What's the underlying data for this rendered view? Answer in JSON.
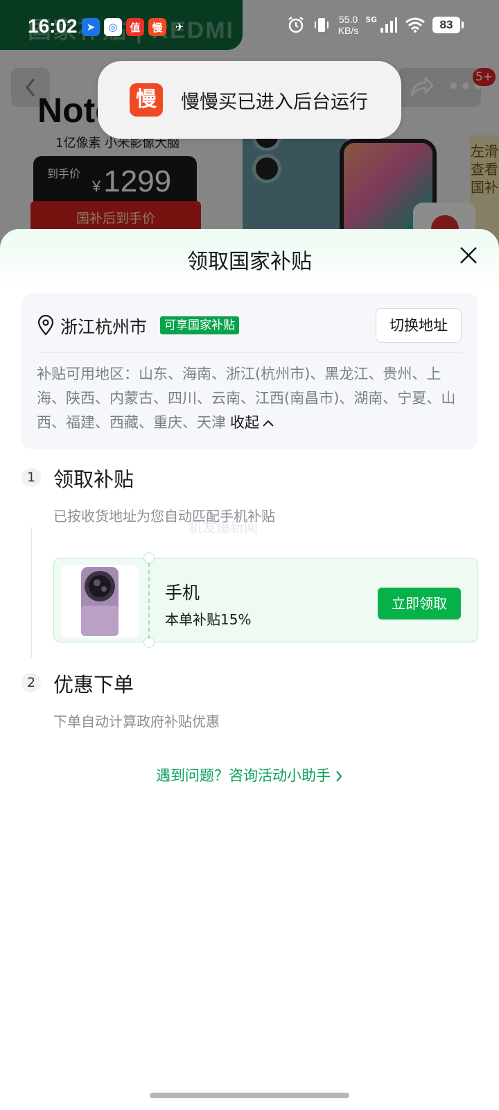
{
  "status_bar": {
    "time": "16:02",
    "net_speed_value": "55.0",
    "net_speed_unit": "KB/s",
    "network_type": "5G",
    "battery": "83",
    "notification_icons": [
      "maps-icon",
      "messages-icon",
      "zhi-icon",
      "manman-icon",
      "bird-icon"
    ]
  },
  "background_page": {
    "banner_text": "国家补贴 | REDMI",
    "product_model": "Note",
    "product_sub": "1亿像素 小米影像大脑",
    "price_label": "到手价",
    "currency": "¥",
    "price": "1299",
    "red_strip_text": "国补后到手价",
    "badge": "5+",
    "side_tab": "左滑查看国补"
  },
  "toast": {
    "icon_char": "慢",
    "text": "慢慢买已进入后台运行"
  },
  "sheet": {
    "title": "领取国家补贴",
    "address": {
      "city": "浙江杭州市",
      "tag": "可享国家补贴",
      "switch_button": "切换地址",
      "regions_text": "补贴可用地区：山东、海南、浙江(杭州市)、黑龙江、贵州、上海、陕西、内蒙古、四川、云南、江西(南昌市)、湖南、宁夏、山西、福建、西藏、重庆、天津",
      "collapse_label": "收起"
    },
    "steps": [
      {
        "number": "1",
        "title": "领取补贴",
        "desc": "已按收货地址为您自动匹配手机补贴"
      },
      {
        "number": "2",
        "title": "优惠下单",
        "desc": "下单自动计算政府补贴优惠"
      }
    ],
    "coupon": {
      "name": "手机",
      "rate": "本单补贴15%",
      "button": "立即领取"
    },
    "help_link": "遇到问题？咨询活动小助手",
    "watermark": "机友爆新闻"
  },
  "colors": {
    "accent_green": "#07b24a",
    "tag_green": "#0aa34b",
    "link_green": "#0aa05a",
    "toast_icon": "#f04a25"
  }
}
